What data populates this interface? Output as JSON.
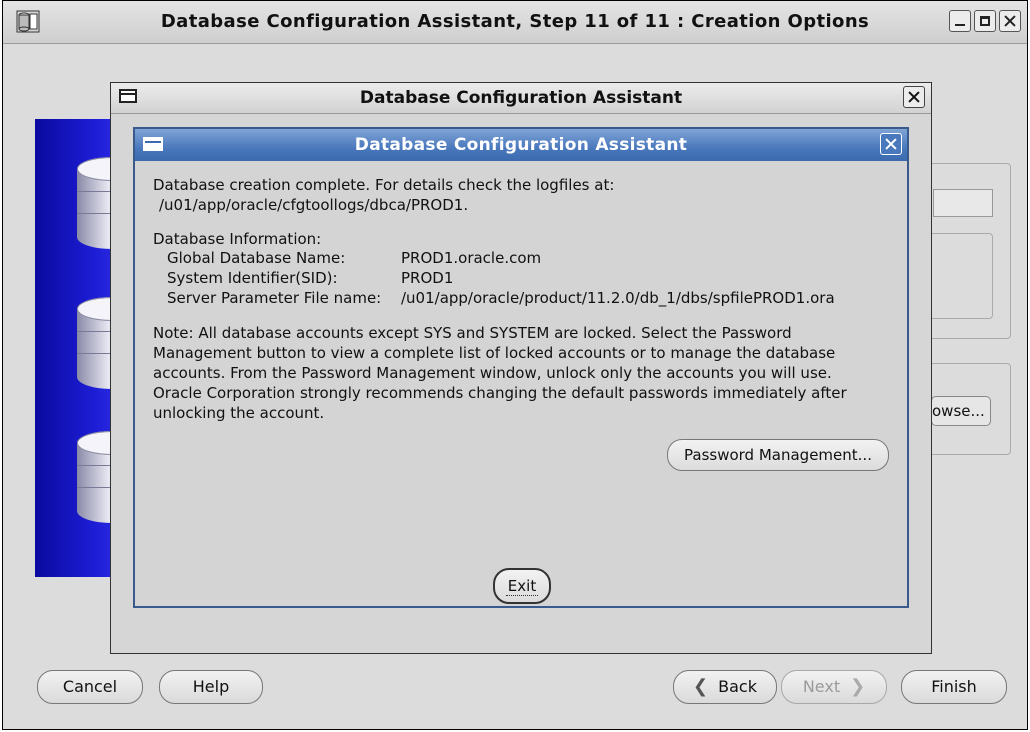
{
  "main_window": {
    "title": "Database Configuration Assistant, Step 11 of 11 : Creation Options",
    "buttons": {
      "cancel": "Cancel",
      "help": "Help",
      "back": "Back",
      "next": "Next",
      "finish": "Finish"
    },
    "browse_partial": "owse..."
  },
  "middle_dialog": {
    "title": "Database Configuration Assistant"
  },
  "front_dialog": {
    "title": "Database Configuration Assistant",
    "completion_line1": "Database creation complete. For details check the logfiles at:",
    "completion_line2": "/u01/app/oracle/cfgtoollogs/dbca/PROD1.",
    "info_heading": "Database Information:",
    "info": [
      {
        "label": "Global Database Name:",
        "value": "PROD1.oracle.com"
      },
      {
        "label": "System Identifier(SID):",
        "value": "PROD1"
      },
      {
        "label": "Server Parameter File name:",
        "value": "/u01/app/oracle/product/11.2.0/db_1/dbs/spfilePROD1.ora"
      }
    ],
    "note_lines": [
      "Note: All database accounts except SYS and SYSTEM are locked. Select the Password",
      "Management button to view a complete list of locked accounts or to manage the database",
      "accounts. From the Password Management window, unlock only the accounts you will use.",
      "Oracle Corporation strongly recommends changing the default passwords immediately after",
      "unlocking the account."
    ],
    "password_button": "Password Management...",
    "exit_button": "Exit"
  },
  "icons": [
    "database-app-icon",
    "window-menu-icon",
    "close-icon",
    "minimize-icon",
    "maximize-icon",
    "chevron-left-icon",
    "chevron-right-icon"
  ]
}
